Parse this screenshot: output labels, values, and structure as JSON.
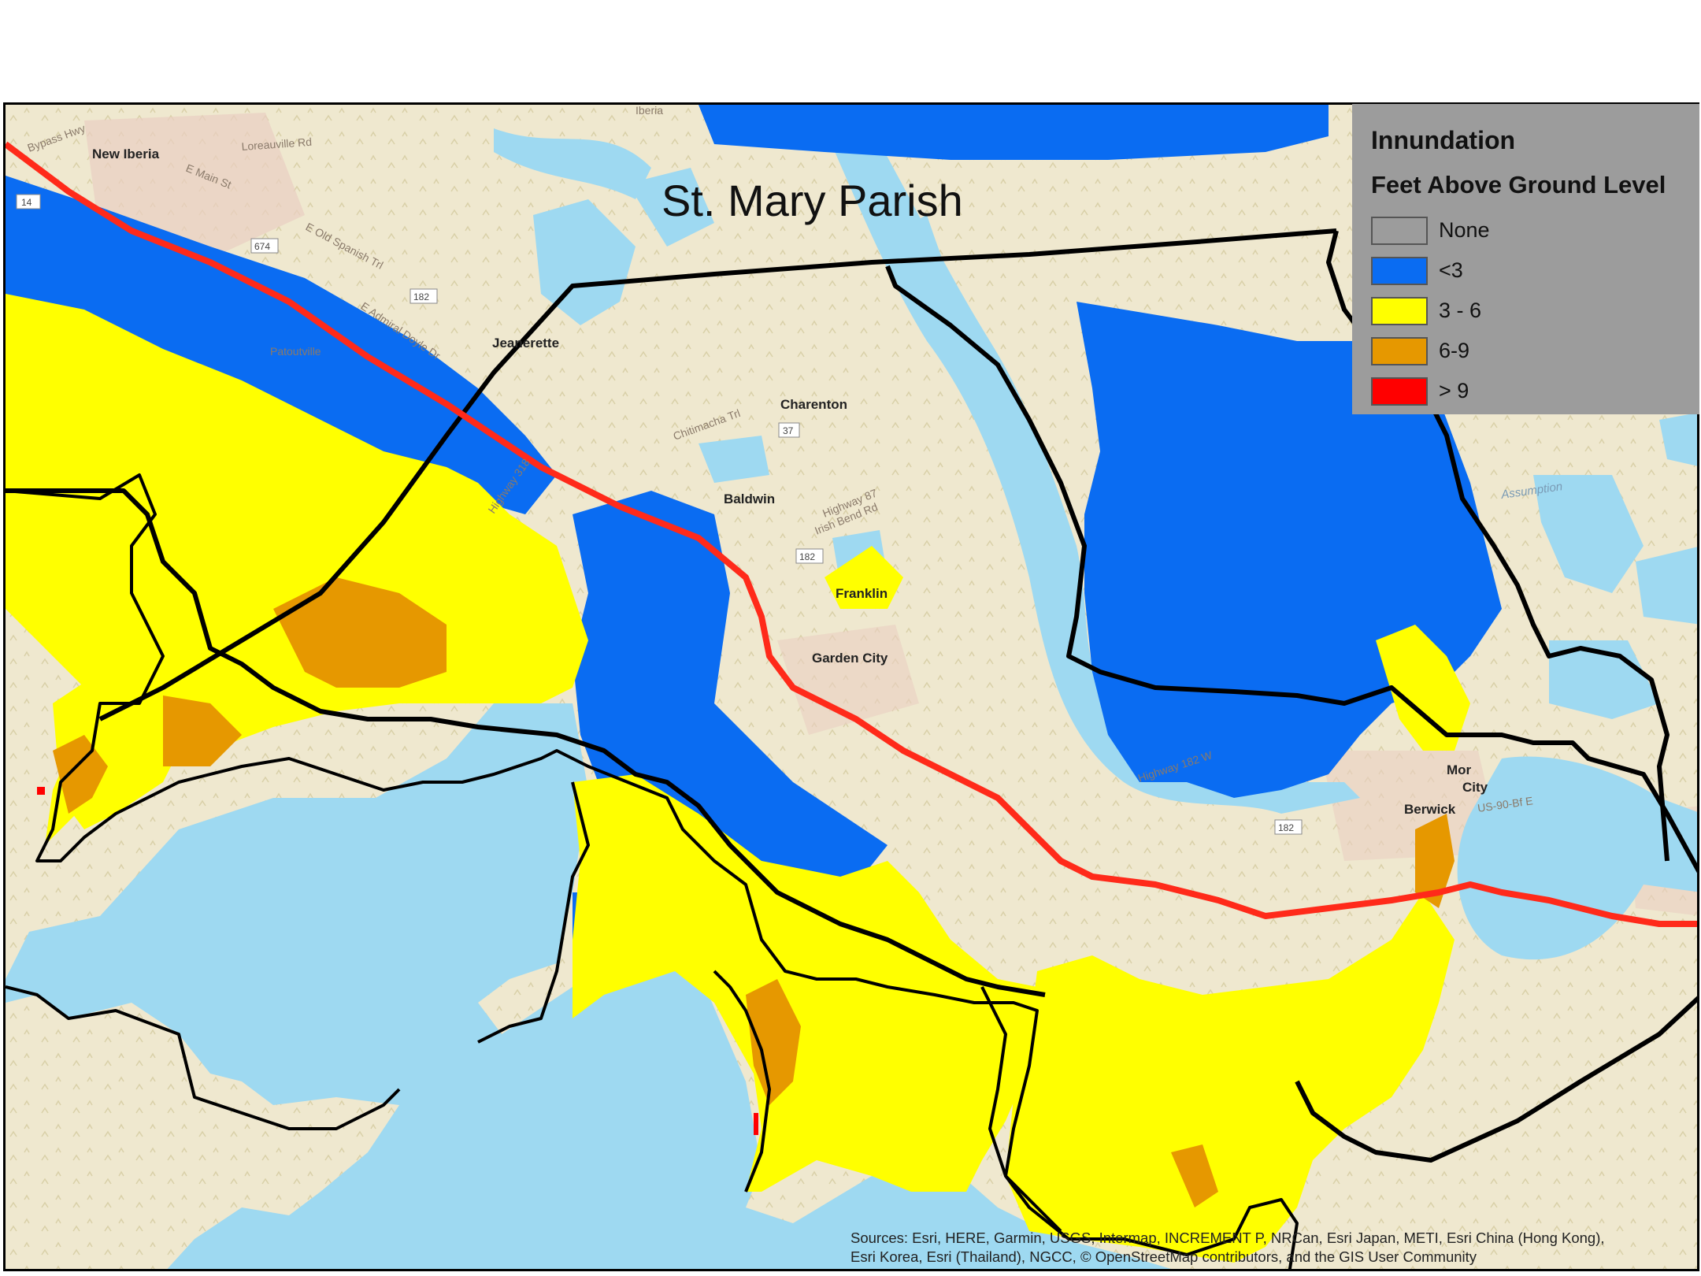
{
  "map": {
    "title": "St. Mary Parish",
    "legend": {
      "title": "Innundation",
      "subtitle": "Feet Above Ground Level",
      "items": [
        {
          "label": "None",
          "color": "#9c9c9c"
        },
        {
          "label": "<3",
          "color": "#0a6cf2"
        },
        {
          "label": "3 - 6",
          "color": "#ffff00"
        },
        {
          "label": "6-9",
          "color": "#e69800"
        },
        {
          "label": "> 9",
          "color": "#ff0000"
        }
      ]
    },
    "places": {
      "new_iberia": "New Iberia",
      "jeanerette": "Jeanerette",
      "charenton": "Charenton",
      "baldwin": "Baldwin",
      "franklin": "Franklin",
      "garden_city": "Garden City",
      "patoutville": "Patoutville",
      "iberia": "Iberia",
      "morgan_city_1": "Mor",
      "morgan_city_2": "City",
      "berwick": "Berwick"
    },
    "roads": {
      "bypass": "Bypass Hwy",
      "loreauville": "Loreauville Rd",
      "e_main": "E Main St",
      "old_spanish": "E Old Spanish Trl",
      "admiral": "E Admiral Doyle Dr",
      "hwy_318": "Highway 318",
      "chitimacha": "Chitimacha Trl",
      "hwy_87": "Highway 87",
      "irish_bend": "Irish Bend Rd",
      "hwy_182w": "Highway 182 W",
      "us90": "US-90-Bf E",
      "assumption": "Assumption"
    },
    "shields": {
      "s14": "14",
      "s674": "674",
      "s182a": "182",
      "s37": "37",
      "s182b": "182",
      "s182c": "182"
    },
    "attribution": [
      "Sources: Esri, HERE, Garmin, USGS, Intermap, INCREMENT P, NRCan, Esri Japan, METI, Esri China (Hong Kong),",
      "Esri Korea, Esri (Thailand), NGCC, © OpenStreetMap contributors, and the GIS User Community"
    ]
  }
}
